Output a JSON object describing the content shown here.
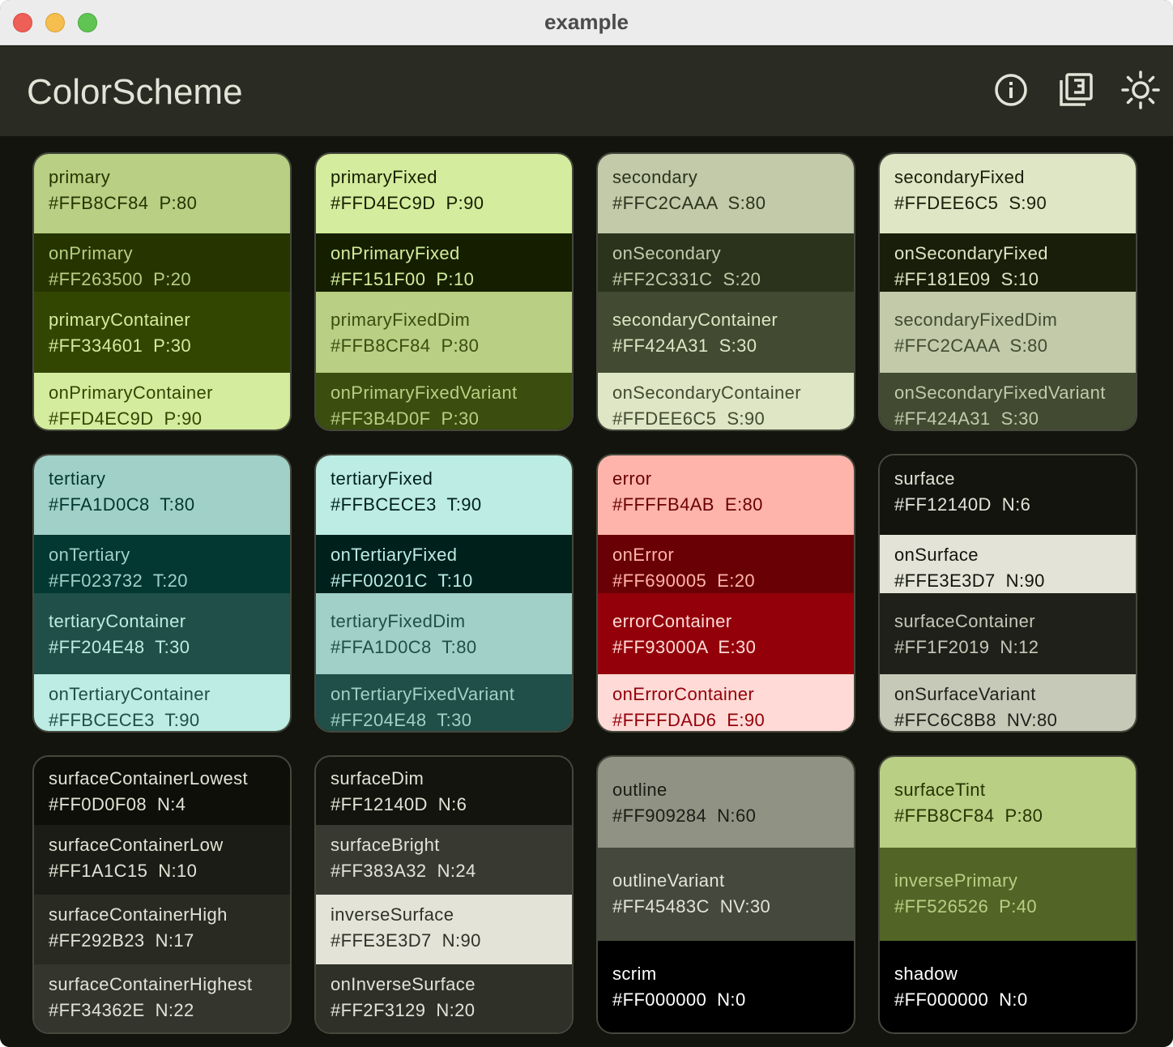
{
  "window": {
    "title": "example"
  },
  "appbar": {
    "title": "ColorScheme",
    "icons": [
      "info-icon",
      "layers-3-icon",
      "brightness-icon"
    ]
  },
  "colors": {
    "accent_dark": "#12140D",
    "appbar": "#2A2C24"
  },
  "cards": [
    {
      "swatches": [
        {
          "name": "primary",
          "code": "#FFB8CF84  P:80",
          "bg": "#B8CF84",
          "fg": "#263500"
        },
        {
          "name": "onPrimary",
          "code": "#FF263500  P:20",
          "bg": "#263500",
          "fg": "#B8CF84"
        },
        {
          "name": "primaryContainer",
          "code": "#FF334601  P:30",
          "bg": "#334601",
          "fg": "#D4EC9D"
        },
        {
          "name": "onPrimaryContainer",
          "code": "#FFD4EC9D  P:90",
          "bg": "#D4EC9D",
          "fg": "#334601"
        }
      ]
    },
    {
      "swatches": [
        {
          "name": "primaryFixed",
          "code": "#FFD4EC9D  P:90",
          "bg": "#D4EC9D",
          "fg": "#151F00"
        },
        {
          "name": "onPrimaryFixed",
          "code": "#FF151F00  P:10",
          "bg": "#151F00",
          "fg": "#D4EC9D"
        },
        {
          "name": "primaryFixedDim",
          "code": "#FFB8CF84  P:80",
          "bg": "#B8CF84",
          "fg": "#3B4D0F"
        },
        {
          "name": "onPrimaryFixedVariant",
          "code": "#FF3B4D0F  P:30",
          "bg": "#3B4D0F",
          "fg": "#B8CF84"
        }
      ]
    },
    {
      "swatches": [
        {
          "name": "secondary",
          "code": "#FFC2CAAA  S:80",
          "bg": "#C2CAAA",
          "fg": "#2C331C"
        },
        {
          "name": "onSecondary",
          "code": "#FF2C331C  S:20",
          "bg": "#2C331C",
          "fg": "#C2CAAA"
        },
        {
          "name": "secondaryContainer",
          "code": "#FF424A31  S:30",
          "bg": "#424A31",
          "fg": "#DEE6C5"
        },
        {
          "name": "onSecondaryContainer",
          "code": "#FFDEE6C5  S:90",
          "bg": "#DEE6C5",
          "fg": "#424A31"
        }
      ]
    },
    {
      "swatches": [
        {
          "name": "secondaryFixed",
          "code": "#FFDEE6C5  S:90",
          "bg": "#DEE6C5",
          "fg": "#181E09"
        },
        {
          "name": "onSecondaryFixed",
          "code": "#FF181E09  S:10",
          "bg": "#181E09",
          "fg": "#DEE6C5"
        },
        {
          "name": "secondaryFixedDim",
          "code": "#FFC2CAAA  S:80",
          "bg": "#C2CAAA",
          "fg": "#424A31"
        },
        {
          "name": "onSecondaryFixedVariant",
          "code": "#FF424A31  S:30",
          "bg": "#424A31",
          "fg": "#C2CAAA"
        }
      ]
    },
    {
      "swatches": [
        {
          "name": "tertiary",
          "code": "#FFA1D0C8  T:80",
          "bg": "#A1D0C8",
          "fg": "#023732"
        },
        {
          "name": "onTertiary",
          "code": "#FF023732  T:20",
          "bg": "#023732",
          "fg": "#A1D0C8"
        },
        {
          "name": "tertiaryContainer",
          "code": "#FF204E48  T:30",
          "bg": "#204E48",
          "fg": "#BCECE3"
        },
        {
          "name": "onTertiaryContainer",
          "code": "#FFBCECE3  T:90",
          "bg": "#BCECE3",
          "fg": "#204E48"
        }
      ]
    },
    {
      "swatches": [
        {
          "name": "tertiaryFixed",
          "code": "#FFBCECE3  T:90",
          "bg": "#BCECE3",
          "fg": "#00201C"
        },
        {
          "name": "onTertiaryFixed",
          "code": "#FF00201C  T:10",
          "bg": "#00201C",
          "fg": "#BCECE3"
        },
        {
          "name": "tertiaryFixedDim",
          "code": "#FFA1D0C8  T:80",
          "bg": "#A1D0C8",
          "fg": "#204E48"
        },
        {
          "name": "onTertiaryFixedVariant",
          "code": "#FF204E48  T:30",
          "bg": "#204E48",
          "fg": "#A1D0C8"
        }
      ]
    },
    {
      "swatches": [
        {
          "name": "error",
          "code": "#FFFFB4AB  E:80",
          "bg": "#FFB4AB",
          "fg": "#690005"
        },
        {
          "name": "onError",
          "code": "#FF690005  E:20",
          "bg": "#690005",
          "fg": "#FFB4AB"
        },
        {
          "name": "errorContainer",
          "code": "#FF93000A  E:30",
          "bg": "#93000A",
          "fg": "#FFDAD6"
        },
        {
          "name": "onErrorContainer",
          "code": "#FFFFDAD6  E:90",
          "bg": "#FFDAD6",
          "fg": "#93000A"
        }
      ]
    },
    {
      "swatches": [
        {
          "name": "surface",
          "code": "#FF12140D  N:6",
          "bg": "#12140D",
          "fg": "#E3E3D7"
        },
        {
          "name": "onSurface",
          "code": "#FFE3E3D7  N:90",
          "bg": "#E3E3D7",
          "fg": "#12140D"
        },
        {
          "name": "surfaceContainer",
          "code": "#FF1F2019  N:12",
          "bg": "#1F2019",
          "fg": "#C6C8B8"
        },
        {
          "name": "onSurfaceVariant",
          "code": "#FFC6C8B8  NV:80",
          "bg": "#C6C8B8",
          "fg": "#1F2019"
        }
      ]
    },
    {
      "swatches": [
        {
          "name": "surfaceContainerLowest",
          "code": "#FF0D0F08  N:4",
          "bg": "#0D0F08",
          "fg": "#E3E3D7"
        },
        {
          "name": "surfaceContainerLow",
          "code": "#FF1A1C15  N:10",
          "bg": "#1A1C15",
          "fg": "#E3E3D7"
        },
        {
          "name": "surfaceContainerHigh",
          "code": "#FF292B23  N:17",
          "bg": "#292B23",
          "fg": "#E3E3D7"
        },
        {
          "name": "surfaceContainerHighest",
          "code": "#FF34362E  N:22",
          "bg": "#34362E",
          "fg": "#E3E3D7"
        }
      ]
    },
    {
      "swatches": [
        {
          "name": "surfaceDim",
          "code": "#FF12140D  N:6",
          "bg": "#12140D",
          "fg": "#E3E3D7"
        },
        {
          "name": "surfaceBright",
          "code": "#FF383A32  N:24",
          "bg": "#383A32",
          "fg": "#E3E3D7"
        },
        {
          "name": "inverseSurface",
          "code": "#FFE3E3D7  N:90",
          "bg": "#E3E3D7",
          "fg": "#2F3129"
        },
        {
          "name": "onInverseSurface",
          "code": "#FF2F3129  N:20",
          "bg": "#2F3129",
          "fg": "#E3E3D7"
        }
      ]
    },
    {
      "swatches": [
        {
          "name": "outline",
          "code": "#FF909284  N:60",
          "bg": "#909284",
          "fg": "#1A1C15"
        },
        {
          "name": "outlineVariant",
          "code": "#FF45483C  NV:30",
          "bg": "#45483C",
          "fg": "#E3E3D7"
        },
        {
          "name": "scrim",
          "code": "#FF000000  N:0",
          "bg": "#000000",
          "fg": "#FFFFFF"
        }
      ]
    },
    {
      "swatches": [
        {
          "name": "surfaceTint",
          "code": "#FFB8CF84  P:80",
          "bg": "#B8CF84",
          "fg": "#263500"
        },
        {
          "name": "inversePrimary",
          "code": "#FF526526  P:40",
          "bg": "#526526",
          "fg": "#B8CF84"
        },
        {
          "name": "shadow",
          "code": "#FF000000  N:0",
          "bg": "#000000",
          "fg": "#FFFFFF"
        }
      ]
    }
  ]
}
